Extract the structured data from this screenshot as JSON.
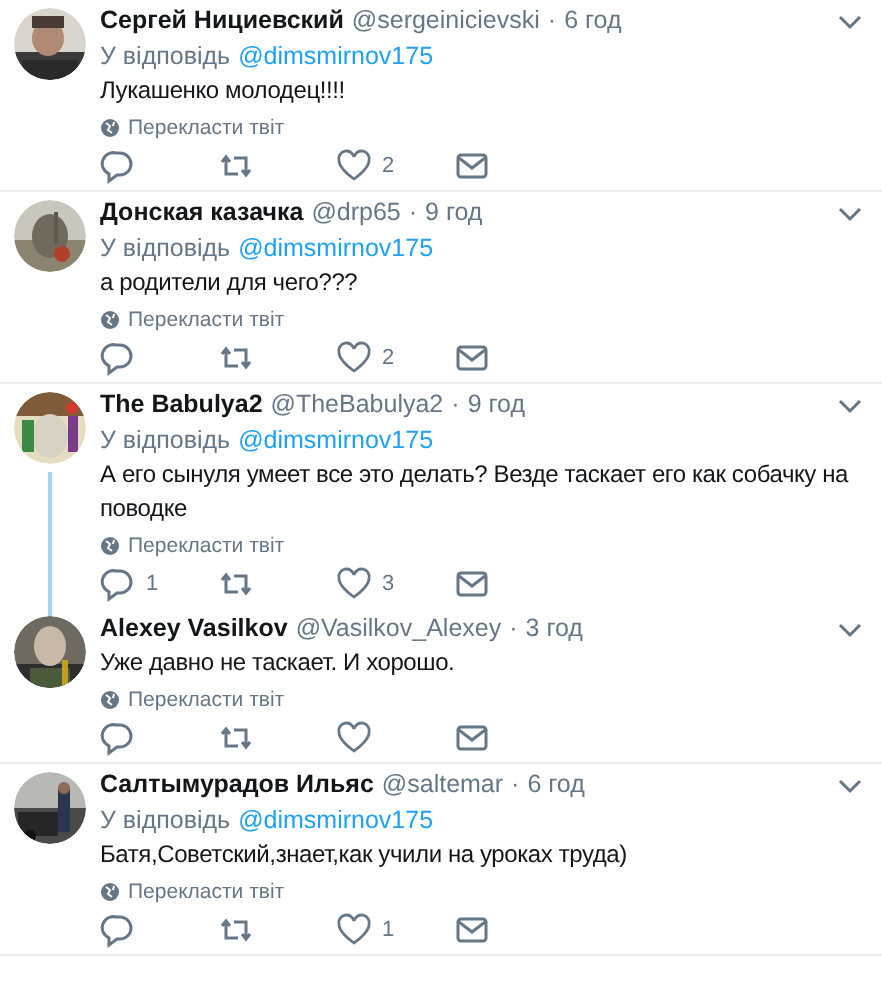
{
  "tweets": [
    {
      "name": "Сергей Нициевский",
      "handle": "@sergeinicievski",
      "separator": "·",
      "time": "6 год",
      "reply_label": "У відповідь",
      "reply_to": "@dimsmirnov175",
      "text": "Лукашенко молодец!!!!",
      "translate": "Перекласти твіт",
      "likes": "2",
      "thread_continues": false
    },
    {
      "name": "Донская казачка",
      "handle": "@drp65",
      "separator": "·",
      "time": "9 год",
      "reply_label": "У відповідь",
      "reply_to": "@dimsmirnov175",
      "text": "а родители для чего???",
      "translate": "Перекласти твіт",
      "likes": "2",
      "thread_continues": false
    },
    {
      "name": "The Babulya2",
      "handle": "@TheBabulya2",
      "separator": "·",
      "time": "9 год",
      "reply_label": "У відповідь",
      "reply_to": "@dimsmirnov175",
      "text": "А его сынуля умеет все это делать? Везде таскает его как собачку на поводке",
      "translate": "Перекласти твіт",
      "replies": "1",
      "likes": "3",
      "thread_continues": true
    },
    {
      "name": "Alexey Vasilkov",
      "handle": "@Vasilkov_Alexey",
      "separator": "·",
      "time": "3 год",
      "text": "Уже давно не таскает. И хорошо.",
      "translate": "Перекласти твіт",
      "thread_continues": false
    },
    {
      "name": "Салтымурадов Ильяс",
      "handle": "@saltemar",
      "separator": "·",
      "time": "6 год",
      "reply_label": "У відповідь",
      "reply_to": "@dimsmirnov175",
      "text": "Батя,Советский,знает,как учили на уроках труда)",
      "translate": "Перекласти твіт",
      "likes": "1",
      "thread_continues": false
    }
  ]
}
